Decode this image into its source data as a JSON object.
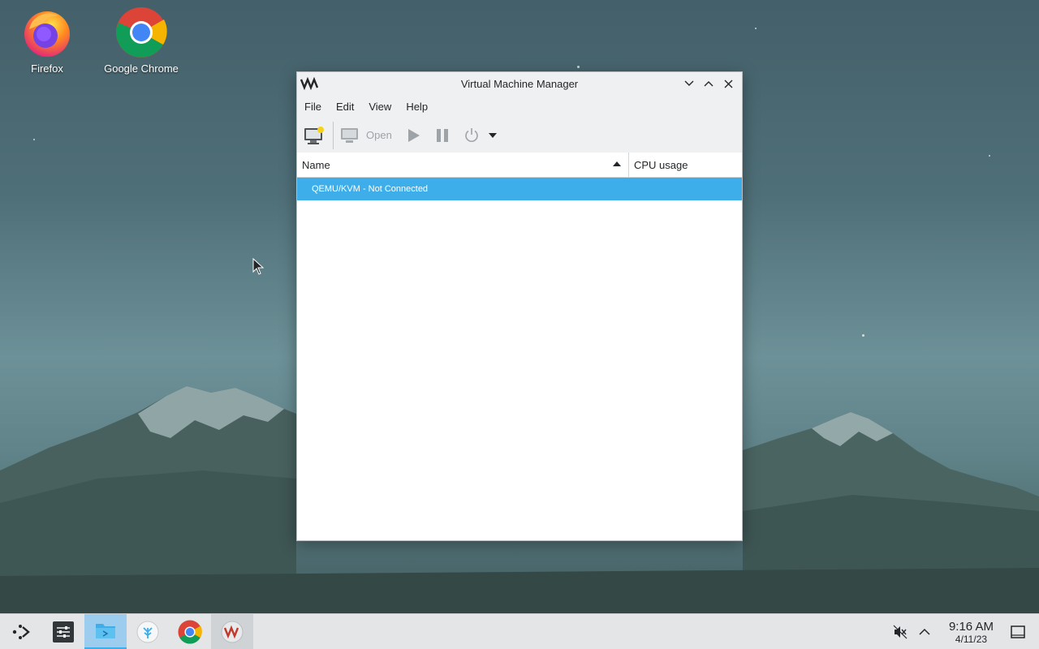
{
  "desktop": {
    "icons": [
      {
        "label": "Firefox"
      },
      {
        "label": "Google Chrome"
      }
    ]
  },
  "window": {
    "title": "Virtual Machine Manager",
    "menu": [
      "File",
      "Edit",
      "View",
      "Help"
    ],
    "toolbar": {
      "open_label": "Open"
    },
    "columns": {
      "name": "Name",
      "cpu": "CPU usage"
    },
    "rows": [
      {
        "name": "QEMU/KVM - Not Connected",
        "selected": true
      }
    ]
  },
  "taskbar": {
    "clock": {
      "time": "9:16 AM",
      "date": "4/11/23"
    }
  },
  "colors": {
    "selection": "#3daee9",
    "window_bg": "#eff0f1",
    "taskbar_bg": "#e3e5e7"
  }
}
